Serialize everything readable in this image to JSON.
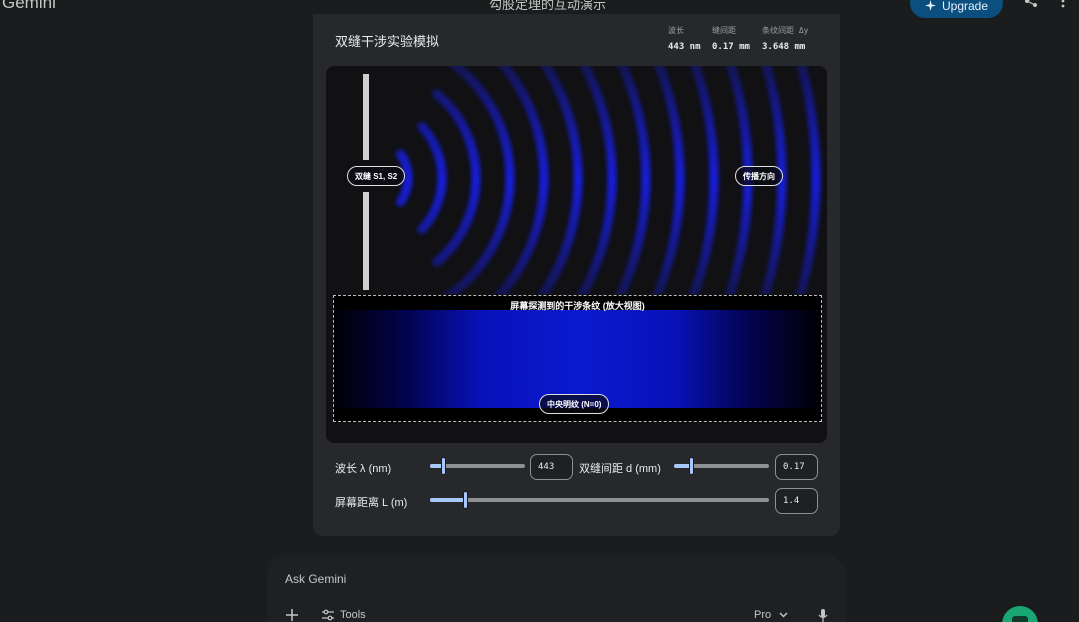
{
  "header": {
    "brand": "Gemini",
    "title": "勾股定理的互动演示",
    "upgrade_label": "Upgrade"
  },
  "simulation": {
    "title": "双缝干涉实验模拟",
    "stats": {
      "labels": [
        "波长",
        "缝间距",
        "条纹间距 Δy"
      ],
      "values": [
        "443 nm",
        "0.17 mm",
        "3.648 mm"
      ]
    },
    "slit_label": "双缝 S1, S2",
    "direction_label": "传播方向",
    "screen_title": "屏幕探测到的干涉条纹 (放大视图)",
    "center_label": "中央明纹 (N=0)"
  },
  "controls": {
    "wavelength": {
      "label": "波长 λ (nm)",
      "value": "443",
      "fraction": 0.15
    },
    "slit_distance": {
      "label": "双缝间距 d (mm)",
      "value": "0.17",
      "fraction": 0.18
    },
    "screen_distance": {
      "label": "屏幕距离 L (m)",
      "value": "1.4",
      "fraction": 0.1
    }
  },
  "ask_bar": {
    "placeholder": "Ask Gemini",
    "tools_label": "Tools",
    "model_label": "Pro"
  },
  "colors": {
    "accent": "#a8c7fa",
    "wave": "#1a22ff",
    "upgrade_bg": "#0b4f7e"
  }
}
